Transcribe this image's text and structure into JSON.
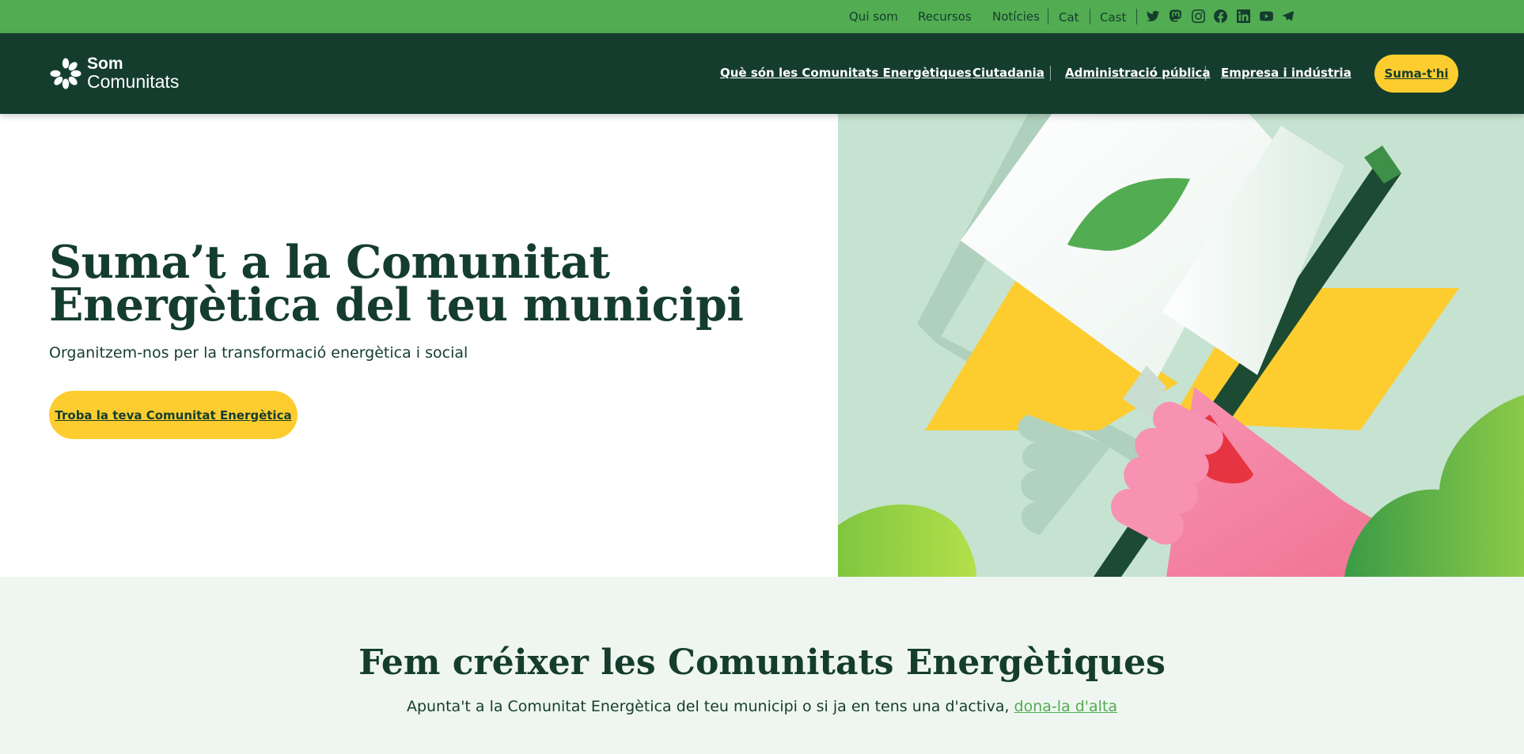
{
  "colors": {
    "topbar": "#52ac52",
    "navbar": "#153d2e",
    "accent_yellow": "#fdcd2f",
    "text_dark": "#153d2e",
    "link_green": "#52ac52",
    "hero_art_bg": "#c6e3d1",
    "lower_bg": "#eff6f1"
  },
  "topbar": {
    "links": [
      "Qui som",
      "Recursos",
      "Notícies"
    ],
    "languages": [
      "Cat",
      "Cast"
    ],
    "social_icons": [
      "twitter-icon",
      "mastodon-icon",
      "instagram-icon",
      "facebook-icon",
      "linkedin-icon",
      "youtube-icon",
      "telegram-icon"
    ]
  },
  "navbar": {
    "logo_line1": "Som",
    "logo_line2": "Comunitats",
    "links": [
      "Què són les Comunitats Energètiques",
      "Ciutadania",
      "Administració pública",
      "Empresa i indústria"
    ],
    "cta": "Suma-t'hi"
  },
  "hero": {
    "title": "Suma’t a la Comunitat Energètica del teu municipi",
    "subtitle": "Organitzem-nos per la transformació energètica i social",
    "cta": "Troba la teva Comunitat Energètica",
    "illustration": "hand-holding-flag-with-leaf"
  },
  "lower": {
    "title": "Fem créixer les Comunitats Energètiques",
    "text": "Apunta't a la Comunitat Energètica del teu municipi o si ja en tens una d'activa, ",
    "link": "dona-la d'alta"
  }
}
